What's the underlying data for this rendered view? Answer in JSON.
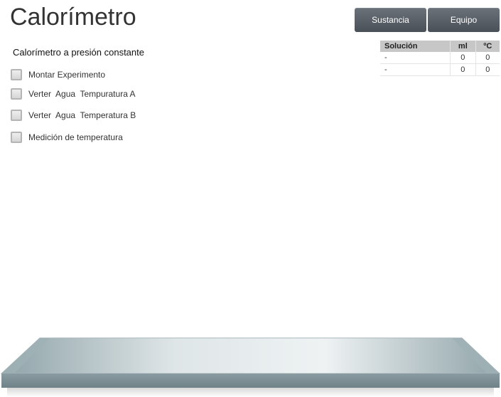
{
  "header": {
    "title": "Calorímetro",
    "subtitle": "Calorímetro a presión constante"
  },
  "toolbar": {
    "sustancia_label": "Sustancia",
    "equipo_label": "Equipo"
  },
  "steps": [
    {
      "label": "Montar Experimento",
      "checked": false
    },
    {
      "label": "Verter  Agua  Tempuratura A",
      "checked": false
    },
    {
      "label": "Verter  Agua  Temperatura B",
      "checked": false
    },
    {
      "label": "Medición de temperatura",
      "checked": false
    }
  ],
  "table": {
    "headers": [
      "Solución",
      "ml",
      "ºC"
    ],
    "rows": [
      [
        "-",
        "0",
        "0"
      ],
      [
        "-",
        "0",
        "0"
      ]
    ]
  },
  "colors": {
    "button": "#5a6068",
    "table_header": "#c7c7c7",
    "bench_top": "#b9c6ca",
    "bench_edge": "#7d9196"
  }
}
